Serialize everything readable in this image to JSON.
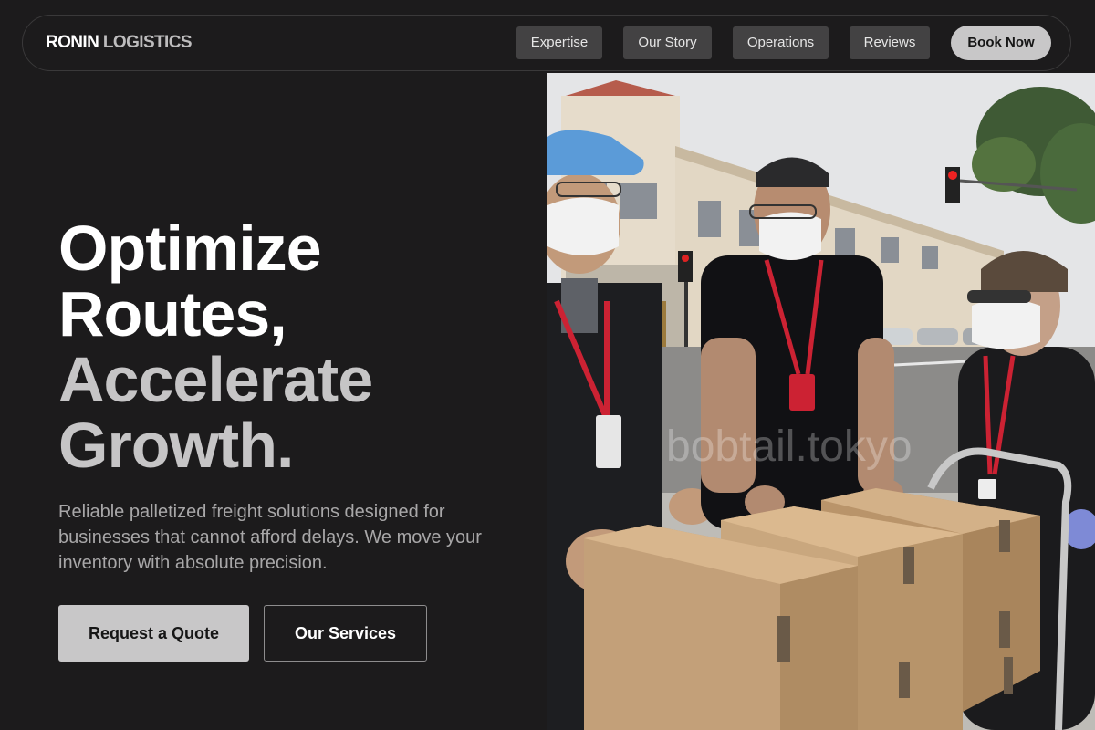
{
  "brand": {
    "name_part1": "RONIN",
    "name_part2": "LOGISTICS"
  },
  "nav": {
    "items": [
      {
        "label": "Expertise"
      },
      {
        "label": "Our Story"
      },
      {
        "label": "Operations"
      },
      {
        "label": "Reviews"
      }
    ],
    "cta_label": "Book Now"
  },
  "hero": {
    "headline_lines": [
      "Optimize",
      "Routes,",
      "Accelerate",
      "Growth."
    ],
    "subtitle": "Reliable palletized freight solutions designed for businesses that cannot afford delays. We move your inventory with absolute precision.",
    "primary_button": "Request a Quote",
    "secondary_button": "Our Services"
  },
  "photo": {
    "watermark": "bobtail.tokyo"
  },
  "colors": {
    "background": "#1c1b1c",
    "nav_button_bg": "#434243",
    "cta_bg": "#c8c7c8",
    "headline_accent": "#c6c5c6",
    "lanyard_red": "#cc2233",
    "cap_blue": "#5b9bd8",
    "box_cardboard": "#c9a77e"
  }
}
